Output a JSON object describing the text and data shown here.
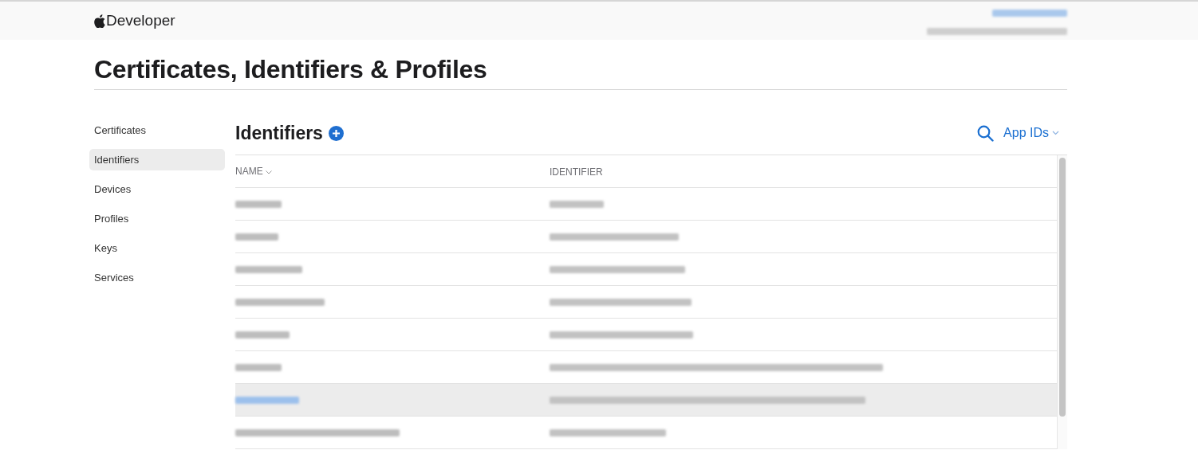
{
  "header": {
    "logo": "Developer"
  },
  "title": "Certificates, Identifiers & Profiles",
  "sidebar": {
    "items": [
      {
        "label": "Certificates",
        "selected": false
      },
      {
        "label": "Identifiers",
        "selected": true
      },
      {
        "label": "Devices",
        "selected": false
      },
      {
        "label": "Profiles",
        "selected": false
      },
      {
        "label": "Keys",
        "selected": false
      },
      {
        "label": "Services",
        "selected": false
      }
    ]
  },
  "section": {
    "title": "Identifiers",
    "filter": "App IDs"
  },
  "table": {
    "columns": [
      {
        "label": "NAME",
        "sorted": true
      },
      {
        "label": "IDENTIFIER",
        "sorted": false
      }
    ],
    "rows": [
      {
        "selected": false
      },
      {
        "selected": false
      },
      {
        "selected": false
      },
      {
        "selected": false
      },
      {
        "selected": false
      },
      {
        "selected": false
      },
      {
        "selected": true
      },
      {
        "selected": false
      }
    ]
  }
}
